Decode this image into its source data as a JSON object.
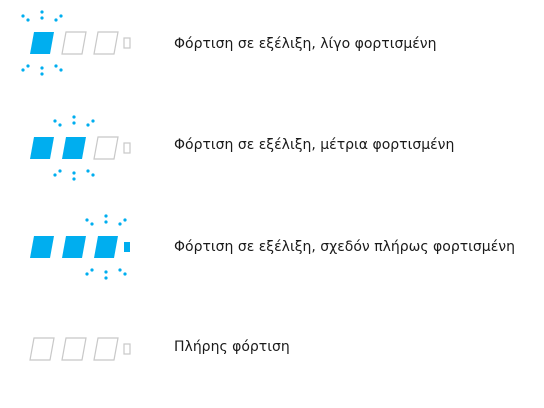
{
  "colors": {
    "fill": "#00aeef",
    "outline": "#c8c8c8"
  },
  "states": [
    {
      "label": "Φόρτιση σε εξέλιξη, λίγο φορτισμένη",
      "segments": [
        1,
        0,
        0,
        0
      ],
      "blinking_segment": 0
    },
    {
      "label": "Φόρτιση σε εξέλιξη, μέτρια φορτισμένη",
      "segments": [
        1,
        1,
        0,
        0
      ],
      "blinking_segment": 1
    },
    {
      "label": "Φόρτιση σε εξέλιξη, σχεδόν πλήρως φορτισμένη",
      "segments": [
        1,
        1,
        1,
        1
      ],
      "blinking_segment": 2
    },
    {
      "label": "Πλήρης φόρτιση",
      "segments": [
        0,
        0,
        0,
        0
      ],
      "blinking_segment": null
    }
  ]
}
